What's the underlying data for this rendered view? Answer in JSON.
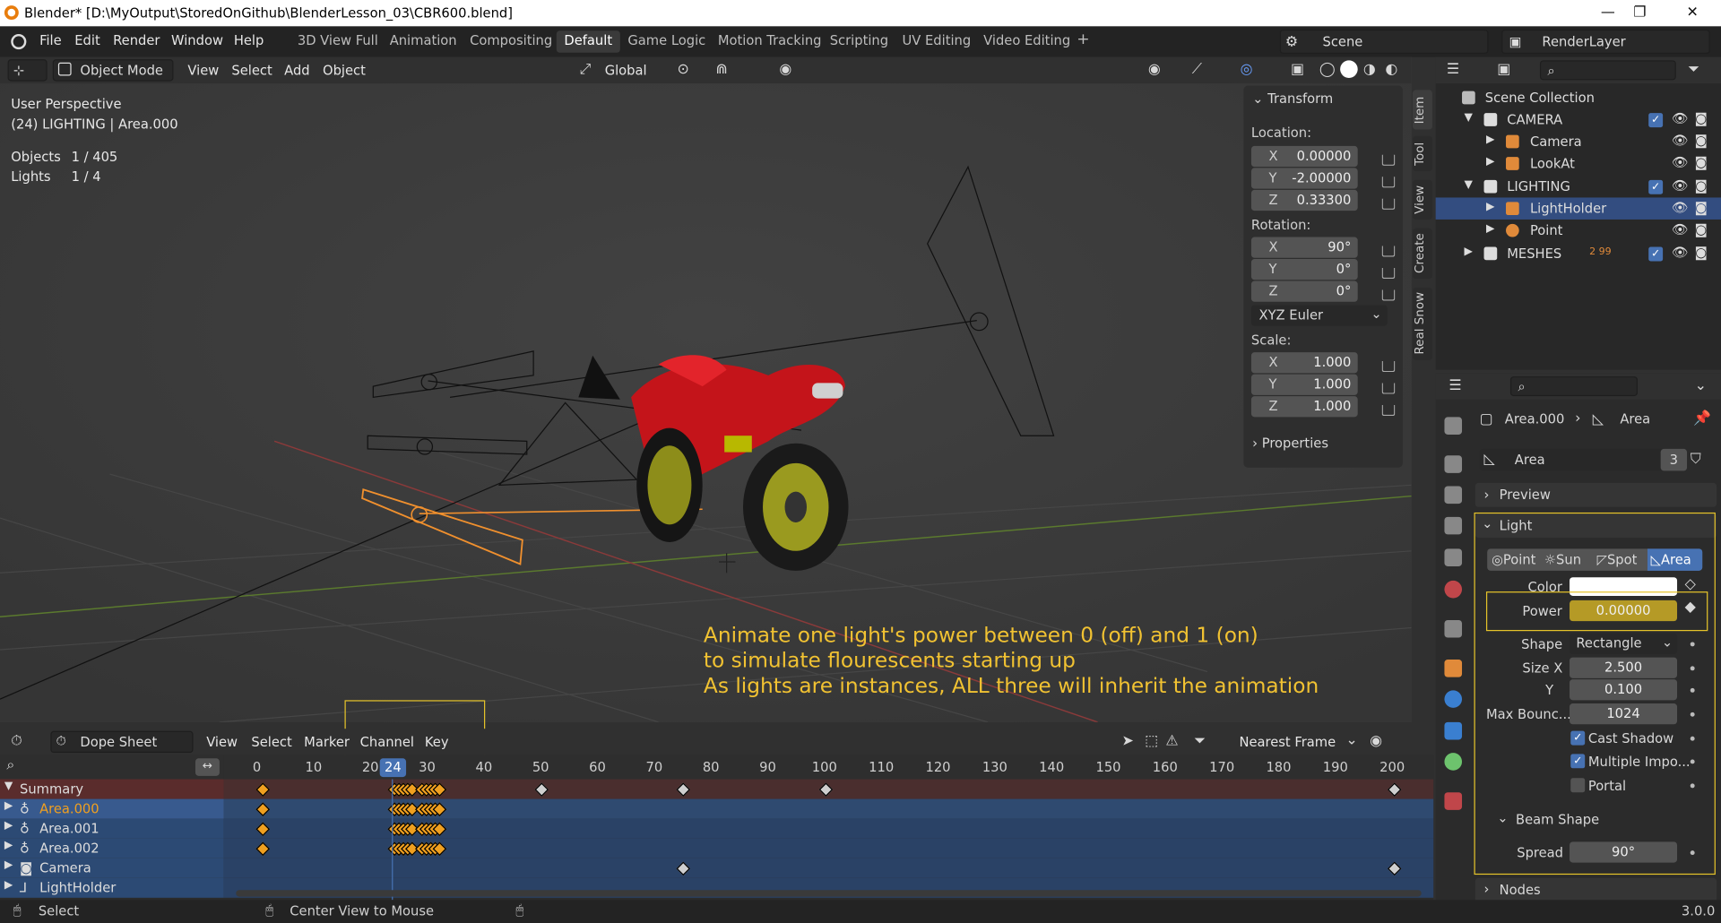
{
  "window": {
    "title": "Blender* [D:\\MyOutput\\StoredOnGithub\\BlenderLesson_03\\CBR600.blend]",
    "min": "—",
    "max": "❐",
    "close": "✕"
  },
  "menu": [
    "File",
    "Edit",
    "Render",
    "Window",
    "Help"
  ],
  "workspaces": [
    "3D View Full",
    "Animation",
    "Compositing",
    "Default",
    "Game Logic",
    "Motion Tracking",
    "Scripting",
    "UV Editing",
    "Video Editing",
    "+"
  ],
  "active_workspace": "Default",
  "scene": {
    "label": "Scene",
    "render_layer": "RenderLayer"
  },
  "viewport_header": {
    "mode": "Object Mode",
    "menus": [
      "View",
      "Select",
      "Add",
      "Object"
    ],
    "orientation": "Global"
  },
  "overlay": {
    "perspective": "User Perspective",
    "active": "(24) LIGHTING | Area.000",
    "stats": [
      {
        "label": "Objects",
        "value": "1 / 405"
      },
      {
        "label": "Lights",
        "value": "1 / 4"
      }
    ]
  },
  "annotation": [
    "Animate one light's power between 0 (off) and 1 (on)",
    "to simulate flourescents starting up",
    "As lights are instances, ALL three will inherit the animation"
  ],
  "npanel": {
    "header": "Transform",
    "location_label": "Location:",
    "location": {
      "x": "0.00000",
      "y": "-2.00000",
      "z": "0.33300"
    },
    "rotation_label": "Rotation:",
    "rotation": {
      "x": "90°",
      "y": "0°",
      "z": "0°"
    },
    "rotation_mode": "XYZ Euler",
    "scale_label": "Scale:",
    "scale": {
      "x": "1.000",
      "y": "1.000",
      "z": "1.000"
    },
    "axis": {
      "x": "X",
      "y": "Y",
      "z": "Z"
    },
    "properties": "Properties"
  },
  "vtabs": [
    "Item",
    "Tool",
    "View",
    "Create",
    "Real Snow"
  ],
  "outliner": {
    "root": "Scene Collection",
    "rows": [
      {
        "name": "CAMERA",
        "level": 1,
        "kind": "collection"
      },
      {
        "name": "Camera",
        "level": 2,
        "kind": "camera"
      },
      {
        "name": "LookAt",
        "level": 2,
        "kind": "empty"
      },
      {
        "name": "LIGHTING",
        "level": 1,
        "kind": "collection"
      },
      {
        "name": "LightHolder",
        "level": 2,
        "kind": "empty",
        "selected": true
      },
      {
        "name": "Point",
        "level": 2,
        "kind": "light"
      },
      {
        "name": "MESHES",
        "level": 1,
        "kind": "collection",
        "extra": "2  99"
      }
    ]
  },
  "properties": {
    "object": "Area.000",
    "data": "Area",
    "datablock": "Area",
    "users": "3",
    "panels": {
      "preview": "Preview",
      "light": "Light",
      "beam": "Beam Shape",
      "nodes": "Nodes"
    },
    "light_types": [
      "Point",
      "Sun",
      "Spot",
      "Area"
    ],
    "active_type": "Area",
    "color_label": "Color",
    "power_label": "Power",
    "power": "0.00000",
    "shape_label": "Shape",
    "shape": "Rectangle",
    "sizex_label": "Size X",
    "sizex": "2.500",
    "sizey_label": "Y",
    "sizey": "0.100",
    "bounces_label": "Max Bounc...",
    "bounces": "1024",
    "checks": [
      {
        "label": "Cast Shadow",
        "on": true
      },
      {
        "label": "Multiple Impo...",
        "on": true
      },
      {
        "label": "Portal",
        "on": false
      }
    ],
    "spread_label": "Spread",
    "spread": "90°"
  },
  "dopesheet": {
    "mode": "Dope Sheet",
    "menus": [
      "View",
      "Select",
      "Marker",
      "Channel",
      "Key"
    ],
    "snap": "Nearest Frame",
    "current_frame": "24",
    "ticks": [
      "0",
      "10",
      "20",
      "30",
      "40",
      "50",
      "60",
      "70",
      "80",
      "90",
      "100",
      "110",
      "120",
      "130",
      "140",
      "150",
      "160",
      "170",
      "180",
      "190",
      "200"
    ],
    "channels": [
      {
        "name": "Summary"
      },
      {
        "name": "Area.000"
      },
      {
        "name": "Area.001"
      },
      {
        "name": "Area.002"
      },
      {
        "name": "Camera"
      },
      {
        "name": "LightHolder"
      }
    ]
  },
  "status": {
    "select": "Select",
    "center": "Center View to Mouse",
    "version": "3.0.0"
  },
  "colors": {
    "accent": "#4772b3",
    "keyframe": "#f0a020",
    "annotation": "#f1c232",
    "power_field": "#b59a26",
    "highlight_box": "#e5c32a"
  }
}
